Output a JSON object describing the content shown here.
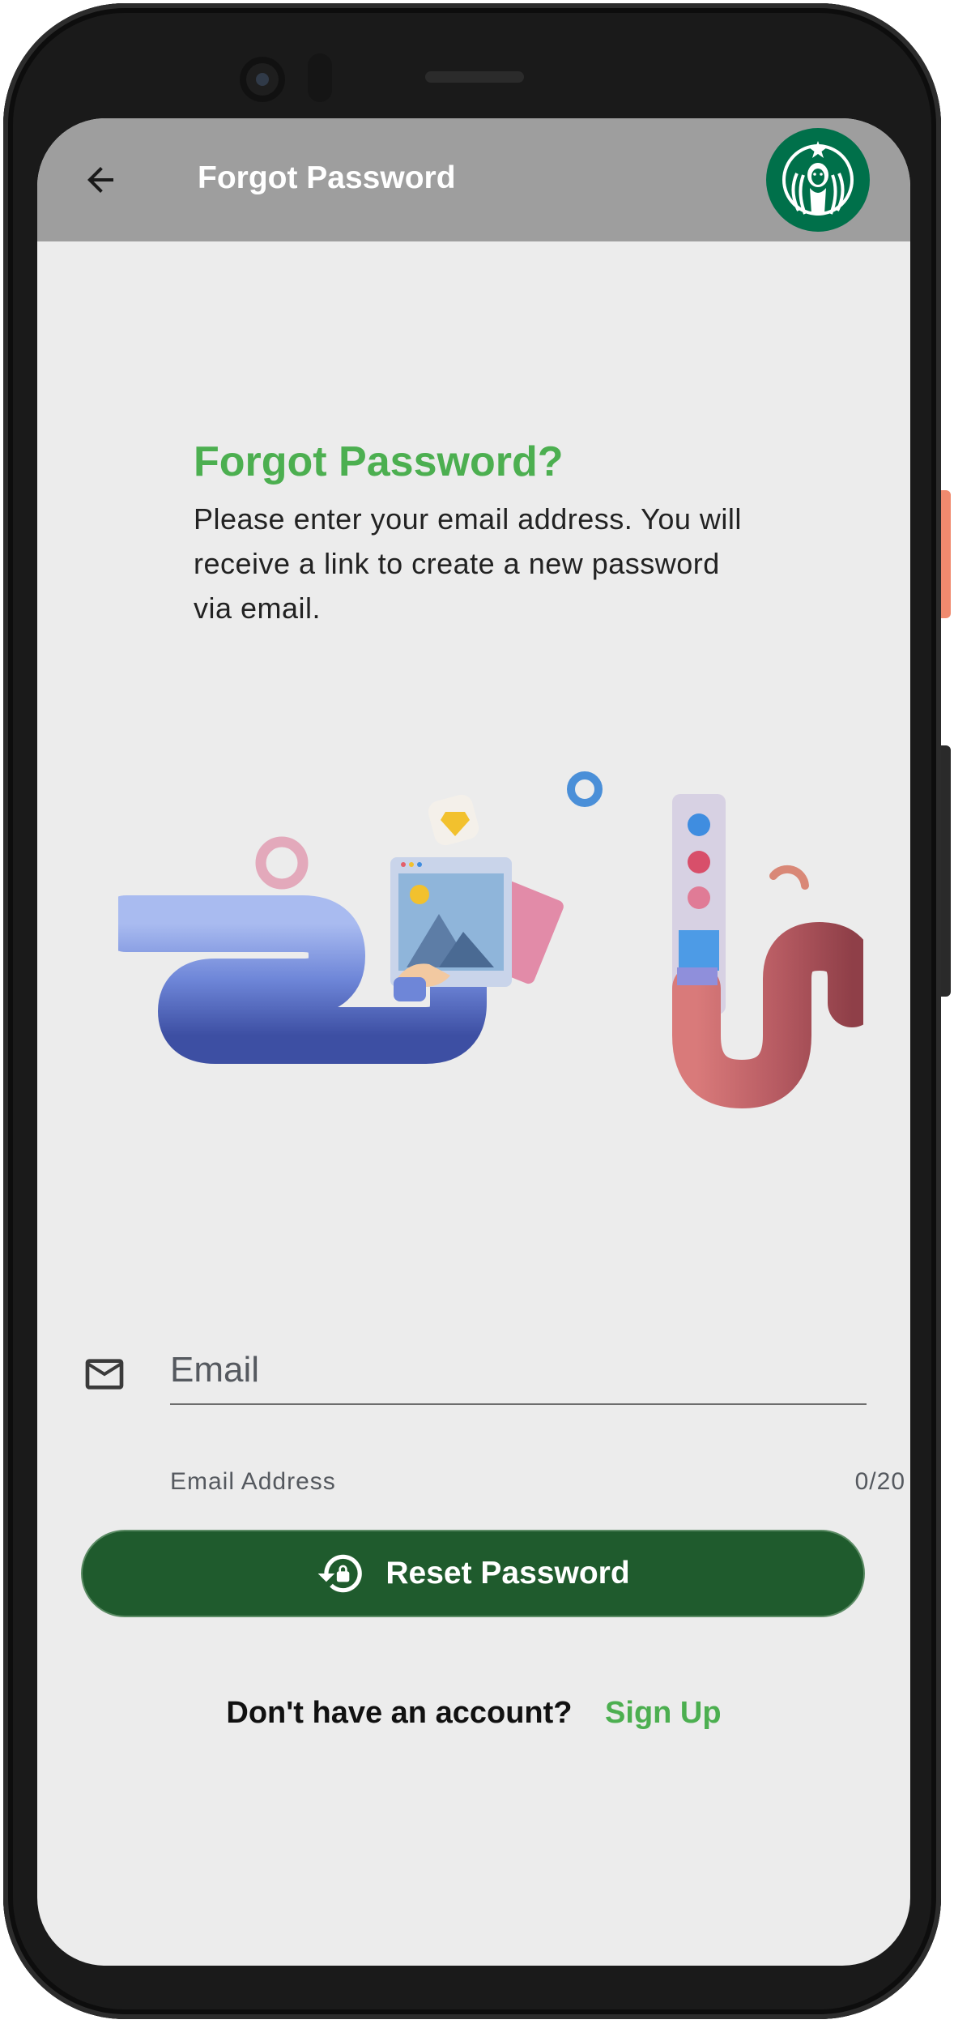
{
  "app_bar": {
    "back_icon": "arrow-left-icon",
    "title": "Forgot Password",
    "logo": "starbucks-siren-logo",
    "background_color": "#9e9e9e"
  },
  "main": {
    "heading": "Forgot Password?",
    "description": "Please enter your email address. You will receive a link to create a new password via email.",
    "illustration": "3d-tubes-hands-illustration"
  },
  "form": {
    "email_icon": "envelope-icon",
    "email_placeholder": "Email",
    "email_value": "",
    "helper_text": "Email Address",
    "char_counter": "0/20"
  },
  "reset_button": {
    "icon": "lock-reset-icon",
    "label": "Reset Password",
    "background_color": "#1f5b2d"
  },
  "footer": {
    "prompt": "Don't have an account?",
    "signup_label": "Sign Up"
  },
  "colors": {
    "accent_green": "#4caf50",
    "screen_background": "#ececec"
  }
}
